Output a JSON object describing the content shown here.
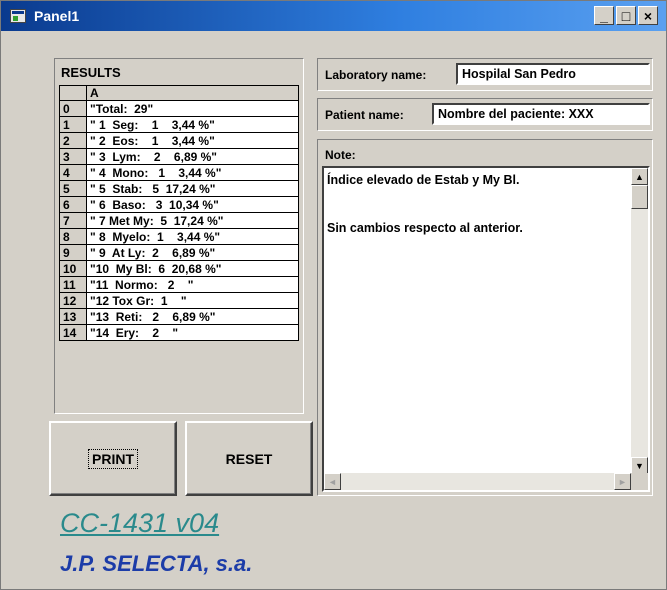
{
  "window": {
    "title": "Panel1",
    "minimize": "_",
    "maximize": "□",
    "close": "×"
  },
  "results": {
    "title": "RESULTS",
    "column_header": "A",
    "rows": [
      {
        "index": "0",
        "value": "\"Total:  29\""
      },
      {
        "index": "1",
        "value": "\" 1  Seg:    1    3,44 %\""
      },
      {
        "index": "2",
        "value": "\" 2  Eos:    1    3,44 %\""
      },
      {
        "index": "3",
        "value": "\" 3  Lym:    2    6,89 %\""
      },
      {
        "index": "4",
        "value": "\" 4  Mono:   1    3,44 %\""
      },
      {
        "index": "5",
        "value": "\" 5  Stab:   5  17,24 %\""
      },
      {
        "index": "6",
        "value": "\" 6  Baso:   3  10,34 %\""
      },
      {
        "index": "7",
        "value": "\" 7 Met My:  5  17,24 %\""
      },
      {
        "index": "8",
        "value": "\" 8  Myelo:  1    3,44 %\""
      },
      {
        "index": "9",
        "value": "\" 9  At Ly:  2    6,89 %\""
      },
      {
        "index": "10",
        "value": "\"10  My Bl:  6  20,68 %\""
      },
      {
        "index": "11",
        "value": "\"11  Normo:   2    \""
      },
      {
        "index": "12",
        "value": "\"12 Tox Gr:  1    \""
      },
      {
        "index": "13",
        "value": "\"13  Reti:   2    6,89 %\""
      },
      {
        "index": "14",
        "value": "\"14  Ery:    2    \""
      }
    ]
  },
  "buttons": {
    "print": "PRINT",
    "reset": "RESET"
  },
  "laboratory": {
    "label": "Laboratory name:",
    "value": "Hospilal San Pedro"
  },
  "patient": {
    "label": "Patient name:",
    "value": "Nombre del paciente: XXX"
  },
  "note": {
    "label": "Note:",
    "lines": [
      "Índice elevado de Estab y My Bl.",
      "",
      "",
      "Sin cambios respecto al anterior."
    ]
  },
  "scroll": {
    "up": "▲",
    "down": "▼",
    "left": "◄",
    "right": "►"
  },
  "brand": {
    "model": "CC-1431 v04",
    "company": "J.P. SELECTA, s.a."
  }
}
